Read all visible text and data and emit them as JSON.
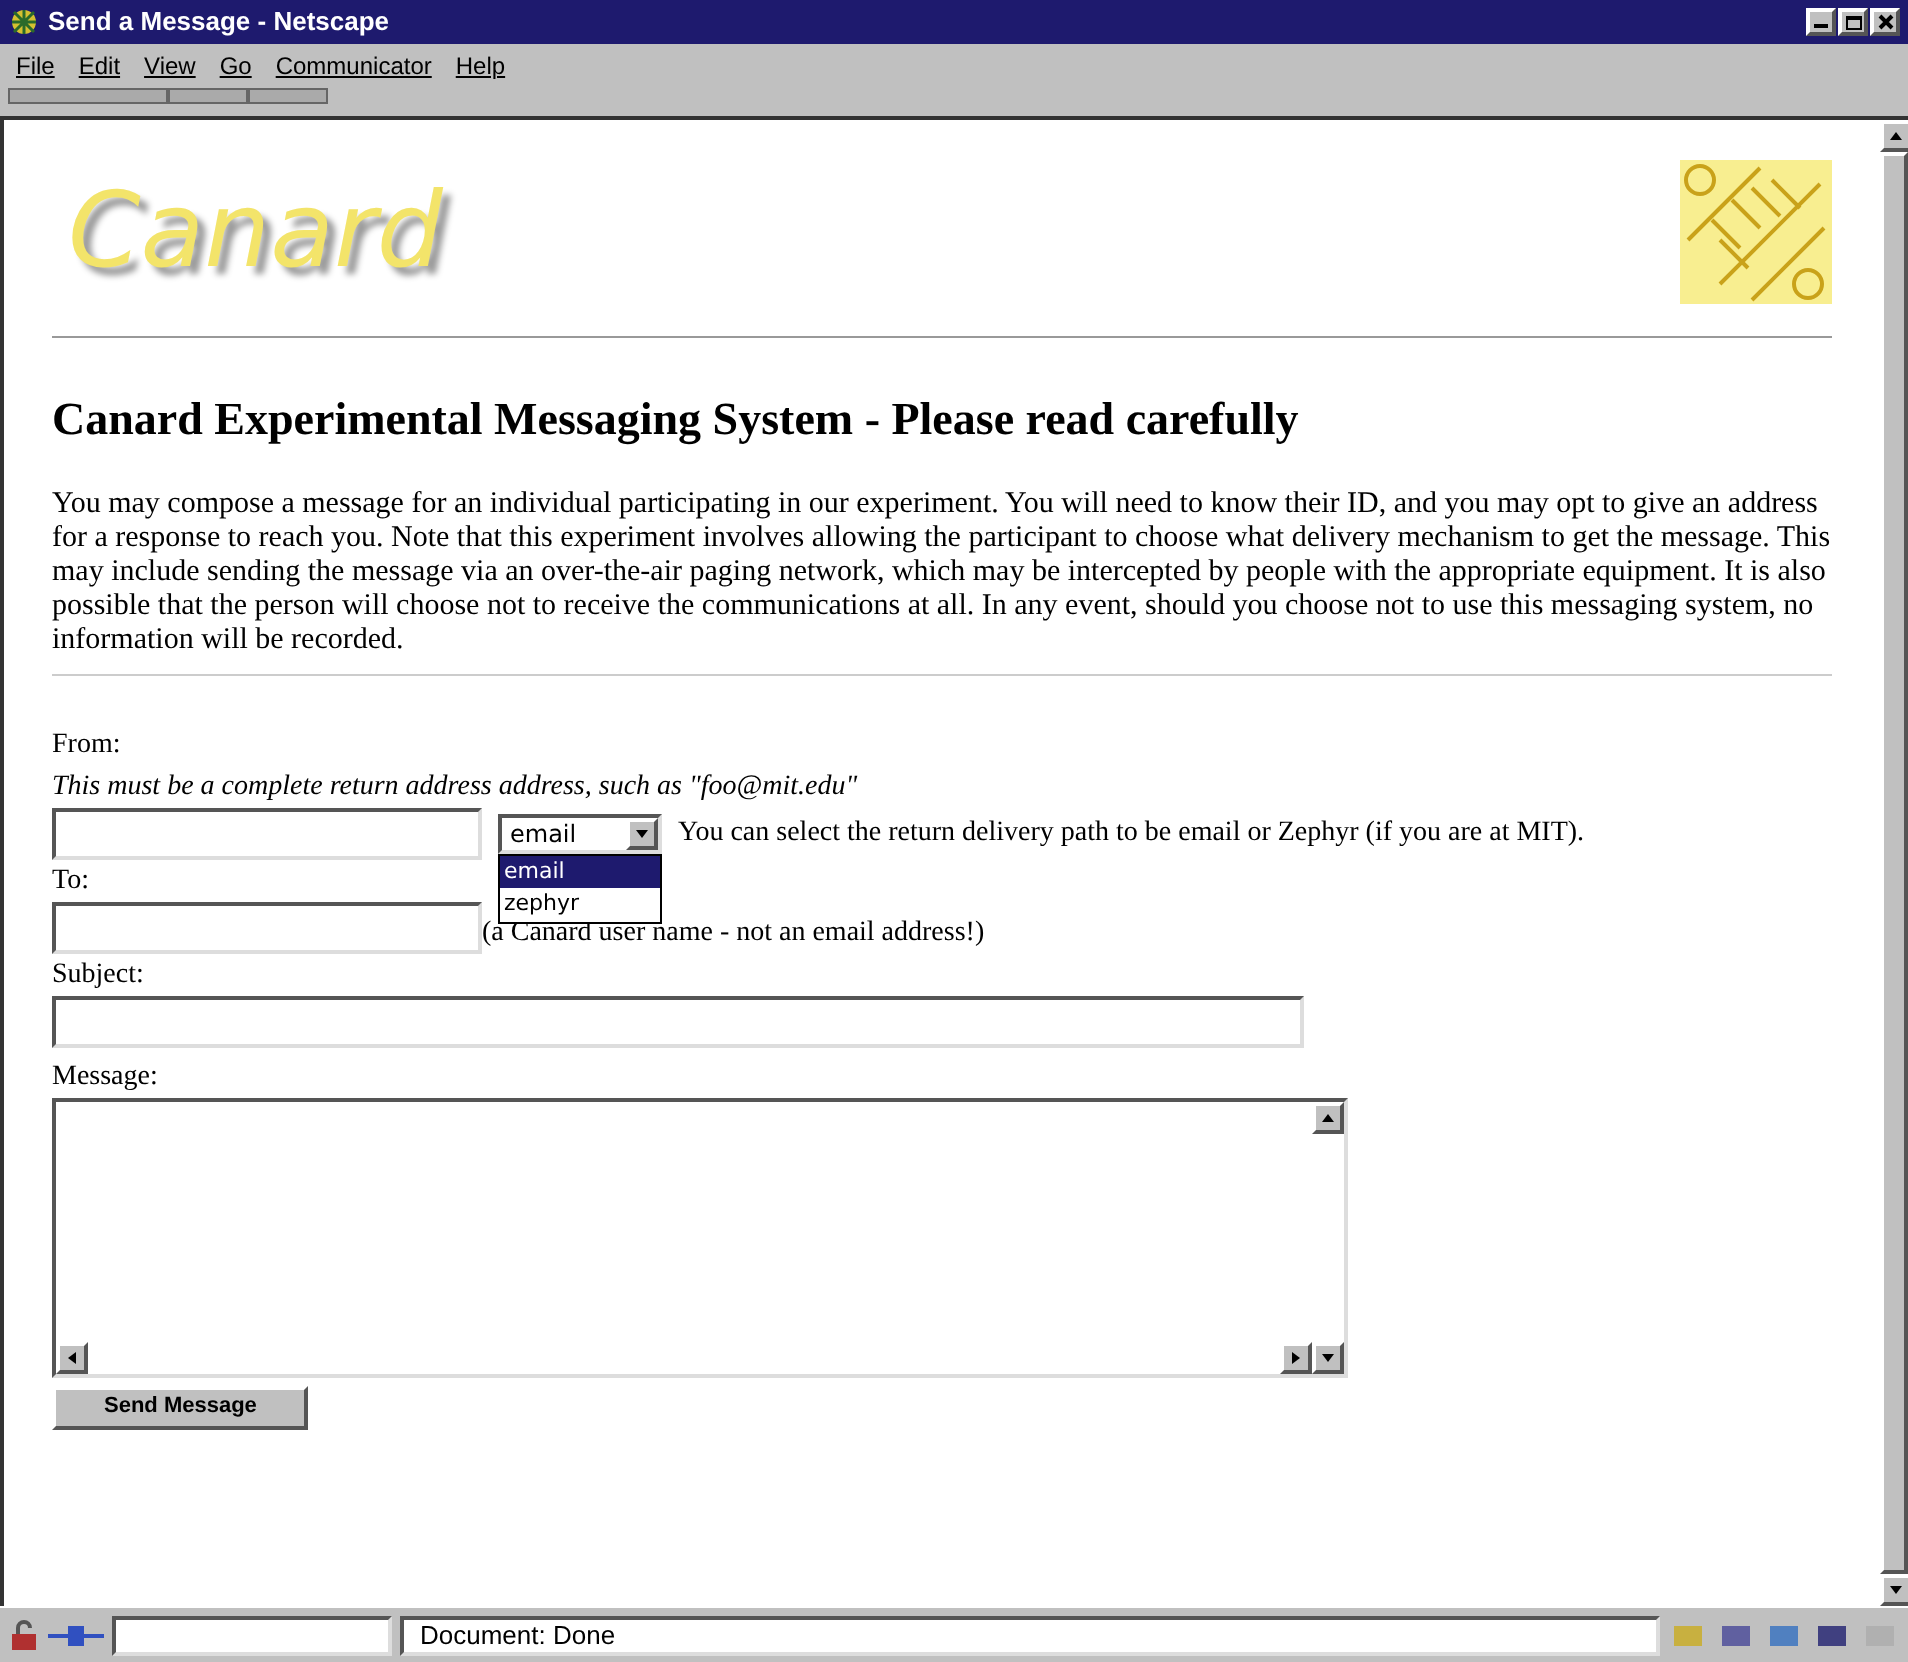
{
  "window": {
    "title": "Send a Message - Netscape"
  },
  "menu": [
    "File",
    "Edit",
    "View",
    "Go",
    "Communicator",
    "Help"
  ],
  "logo": "Canard",
  "heading": "Canard Experimental Messaging System - Please read carefully",
  "intro": "You may compose a message for an individual participating in our experiment. You will need to know their ID, and you may opt to give an address for a response to reach you. Note that this experiment involves allowing the participant to choose what delivery mechanism to get the message. This may include sending the message via an over-the-air paging network, which may be intercepted by people with the appropriate equipment. It is also possible that the person will choose not to receive the communications at all. In any event, should you choose not to use this messaging system, no information will be recorded.",
  "from": {
    "label": "From:",
    "hint": "This must be a complete return address address, such as \"foo@mit.edu\"",
    "note": "You can select the return delivery path to be email or Zephyr (if you are at MIT)."
  },
  "delivery_select": {
    "value": "email",
    "expanded": true,
    "options": [
      {
        "label": "email",
        "selected": true
      },
      {
        "label": "zephyr",
        "selected": false
      }
    ]
  },
  "to": {
    "label": "To:",
    "note": "(a Canard user name - not an email address!)"
  },
  "subject": {
    "label": "Subject:"
  },
  "message": {
    "label": "Message:"
  },
  "send_button": "Send Message",
  "status_bar": {
    "text": "Document: Done"
  }
}
